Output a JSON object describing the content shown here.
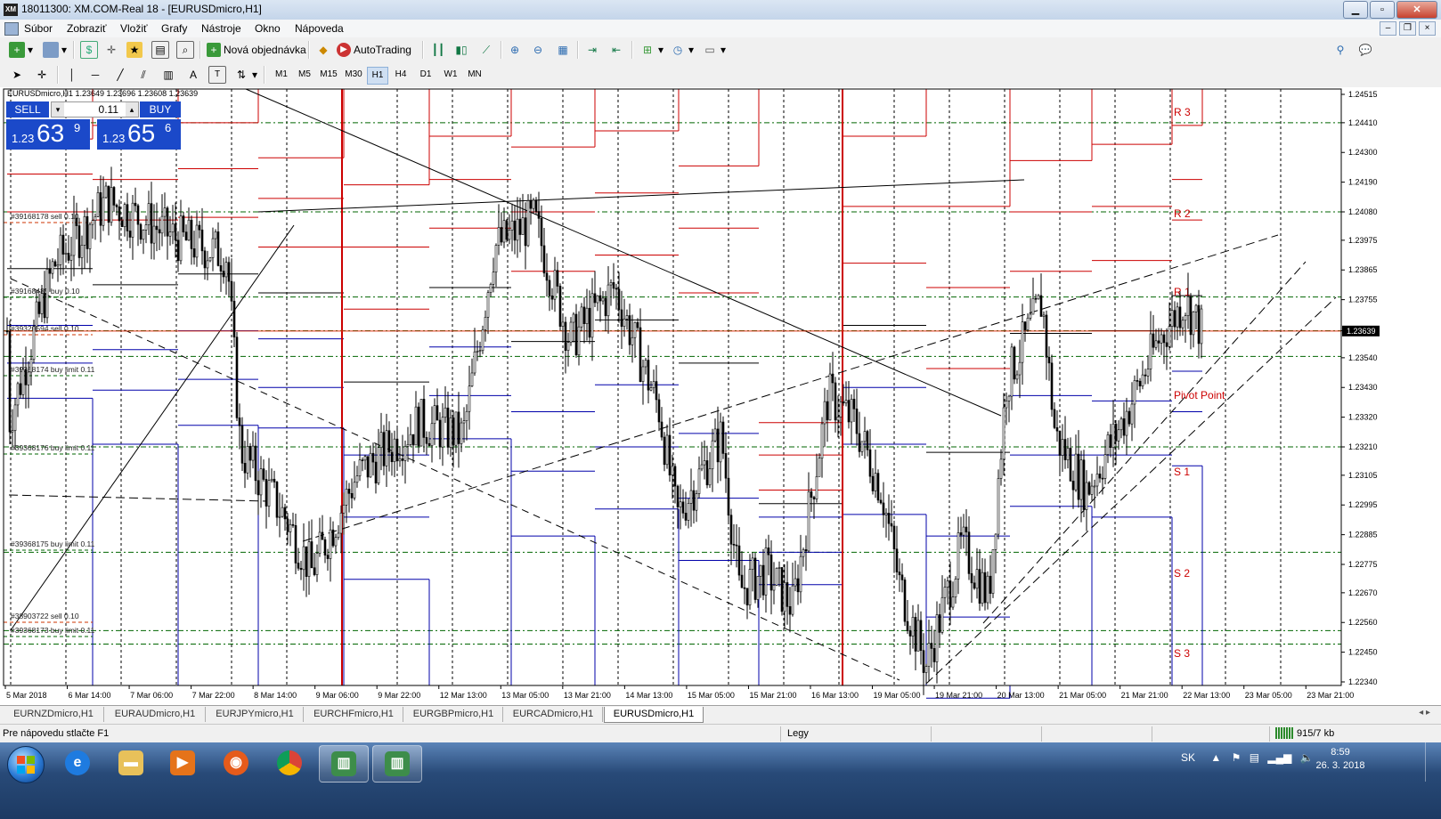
{
  "window": {
    "title": "18011300: XM.COM-Real 18 - [EURUSDmicro,H1]",
    "app_icon": "XM"
  },
  "menu": {
    "items": [
      "Súbor",
      "Zobraziť",
      "Vložiť",
      "Grafy",
      "Nástroje",
      "Okno",
      "Nápoveda"
    ]
  },
  "toolbar": {
    "new_order": "Nová objednávka",
    "autotrading": "AutoTrading"
  },
  "timeframes": [
    "M1",
    "M5",
    "M15",
    "M30",
    "H1",
    "H4",
    "D1",
    "W1",
    "MN"
  ],
  "active_timeframe": "H1",
  "chart": {
    "header": "EURUSDmicro,H1  1.23649 1.23696 1.23608 1.23639",
    "current_price": "1.23639",
    "trade": {
      "sell_label": "SELL",
      "buy_label": "BUY",
      "lot": "0.11",
      "sell_pre": "1.23",
      "sell_big": "63",
      "sell_sup": "9",
      "buy_pre": "1.23",
      "buy_big": "65",
      "buy_sup": "6"
    },
    "pivot_labels": [
      "R 3",
      "R 2",
      "R 1",
      "Pivot Point",
      "S 1",
      "S 2",
      "S 3"
    ],
    "order_labels": [
      "#39168178 sell 0.10",
      "#39168485 buy 0.10",
      "#39320594 sell 0.10",
      "#39368174 buy limit 0.11",
      "#39368176 buy limit 0.11",
      "#39368175 buy limit 0.11",
      "#38903722 sell 0.10",
      "#39368173 buy limit 0.11"
    ],
    "colors": {
      "pivot_red": "#cc0000",
      "support_blue": "#0000aa",
      "grid_green": "#006600",
      "price_bg": "#dd3311"
    }
  },
  "chart_data": {
    "type": "candlestick",
    "symbol": "EURUSDmicro",
    "timeframe": "H1",
    "last_bar": {
      "open": 1.23649,
      "high": 1.23696,
      "low": 1.23608,
      "close": 1.23639
    },
    "y_ticks": [
      "1.24515",
      "1.24410",
      "1.24300",
      "1.24190",
      "1.24080",
      "1.23975",
      "1.23865",
      "1.23755",
      "1.23640",
      "1.23540",
      "1.23430",
      "1.23320",
      "1.23210",
      "1.23105",
      "1.22995",
      "1.22885",
      "1.22775",
      "1.22670",
      "1.22560",
      "1.22450",
      "1.22340"
    ],
    "x_ticks": [
      "5 Mar 2018",
      "6 Mar 14:00",
      "7 Mar 06:00",
      "7 Mar 22:00",
      "8 Mar 14:00",
      "9 Mar 06:00",
      "9 Mar 22:00",
      "12 Mar 13:00",
      "13 Mar 05:00",
      "13 Mar 21:00",
      "14 Mar 13:00",
      "15 Mar 05:00",
      "15 Mar 21:00",
      "16 Mar 13:00",
      "19 Mar 05:00",
      "19 Mar 21:00",
      "20 Mar 13:00",
      "21 Mar 05:00",
      "21 Mar 21:00",
      "22 Mar 13:00",
      "23 Mar 05:00",
      "23 Mar 21:00"
    ],
    "y_range": [
      1.2234,
      1.24515
    ],
    "grid": false
  },
  "symbol_tabs": [
    "EURNZDmicro,H1",
    "EURAUDmicro,H1",
    "EURJPYmicro,H1",
    "EURCHFmicro,H1",
    "EURGBPmicro,H1",
    "EURCADmicro,H1",
    "EURUSDmicro,H1"
  ],
  "active_tab": "EURUSDmicro,H1",
  "status": {
    "help": "Pre nápovedu stlačte F1",
    "profile": "Legy",
    "traffic": "915/7 kb"
  },
  "taskbar": {
    "lang": "SK",
    "time": "8:59",
    "date": "26. 3. 2018"
  }
}
